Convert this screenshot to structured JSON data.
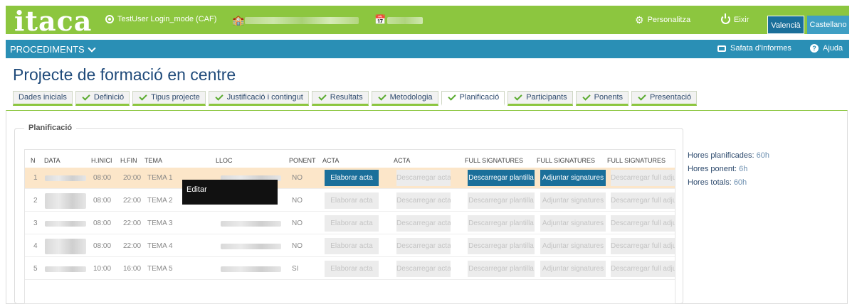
{
  "header": {
    "logo": "itaca",
    "user": "TestUser Login_mode (CAF)",
    "personalitza": "Personalitza",
    "eixir": "Eixir",
    "lang_valencia": "Valencià",
    "lang_castellano": "Castellano"
  },
  "nav": {
    "procediments": "PROCEDIMENTS",
    "safata": "Safata d'Informes",
    "ajuda": "Ajuda"
  },
  "page": {
    "title": "Projecte de formació en centre"
  },
  "tabs": [
    {
      "label": "Dades inicials",
      "checked": false
    },
    {
      "label": "Definició",
      "checked": true
    },
    {
      "label": "Tipus projecte",
      "checked": true
    },
    {
      "label": "Justificació i contingut",
      "checked": true
    },
    {
      "label": "Resultats",
      "checked": true
    },
    {
      "label": "Metodologia",
      "checked": true
    },
    {
      "label": "Planificació",
      "checked": true,
      "active": true
    },
    {
      "label": "Participants",
      "checked": true
    },
    {
      "label": "Ponents",
      "checked": true
    },
    {
      "label": "Presentació",
      "checked": true
    }
  ],
  "section": {
    "legend": "Planificació"
  },
  "table": {
    "headers": {
      "n": "N",
      "data": "DATA",
      "hinici": "H.INICI",
      "hfin": "H.FIN",
      "tema": "TEMA",
      "lloc": "LLOC",
      "ponent": "PONENT",
      "acta1": "ACTA",
      "acta2": "ACTA",
      "fs1": "FULL SIGNATURES",
      "fs2": "FULL SIGNATURES",
      "fs3": "FULL SIGNATURES"
    },
    "buttons": {
      "elaborar": "Elaborar acta",
      "descarregar_acta": "Descarregar acta",
      "descarregar_plantilla": "Descarregar plantilla",
      "adjuntar": "Adjuntar signatures",
      "descarregar_full": "Descarregar full adjunt"
    },
    "rows": [
      {
        "n": "1",
        "hinici": "08:00",
        "hfin": "20:00",
        "tema": "TEMA 1",
        "ponent": "NO",
        "selected": true
      },
      {
        "n": "2",
        "hinici": "08:00",
        "hfin": "22:00",
        "tema": "TEMA 2",
        "ponent": "NO"
      },
      {
        "n": "3",
        "hinici": "08:00",
        "hfin": "22:00",
        "tema": "TEMA 3",
        "ponent": "NO"
      },
      {
        "n": "4",
        "hinici": "08:00",
        "hfin": "22:00",
        "tema": "TEMA 4",
        "ponent": "NO"
      },
      {
        "n": "5",
        "hinici": "10:00",
        "hfin": "16:00",
        "tema": "TEMA 5",
        "ponent": "SI"
      }
    ]
  },
  "tooltip": "Editar",
  "summary": {
    "hores_planificades_label": "Hores planificades:",
    "hores_planificades": "60h",
    "hores_ponent_label": "Hores ponent:",
    "hores_ponent": "6h",
    "hores_totals_label": "Hores totals:",
    "hores_totals": "60h"
  },
  "colors": {
    "green": "#8cc63f",
    "blue_bar": "#2a8fb5",
    "button_blue": "#1a6f9a",
    "selected_row": "#fce6c9"
  }
}
